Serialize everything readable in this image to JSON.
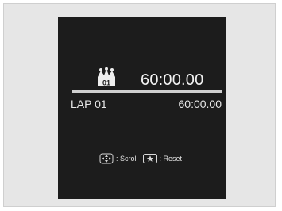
{
  "display": {
    "best_time": "60:00.00",
    "lap_number_badge": "01",
    "lap_label": "LAP 01",
    "lap_time": "60:00.00"
  },
  "hints": {
    "scroll_label": ": Scroll",
    "reset_label": ": Reset"
  },
  "icons": {
    "crown": "crown-icon",
    "scroll": "dpad-scroll-icon",
    "reset": "star-button-icon"
  },
  "colors": {
    "screen_bg": "#1c1c1c",
    "frame_bg": "#e6e6e6",
    "text": "#f2f2f2"
  }
}
